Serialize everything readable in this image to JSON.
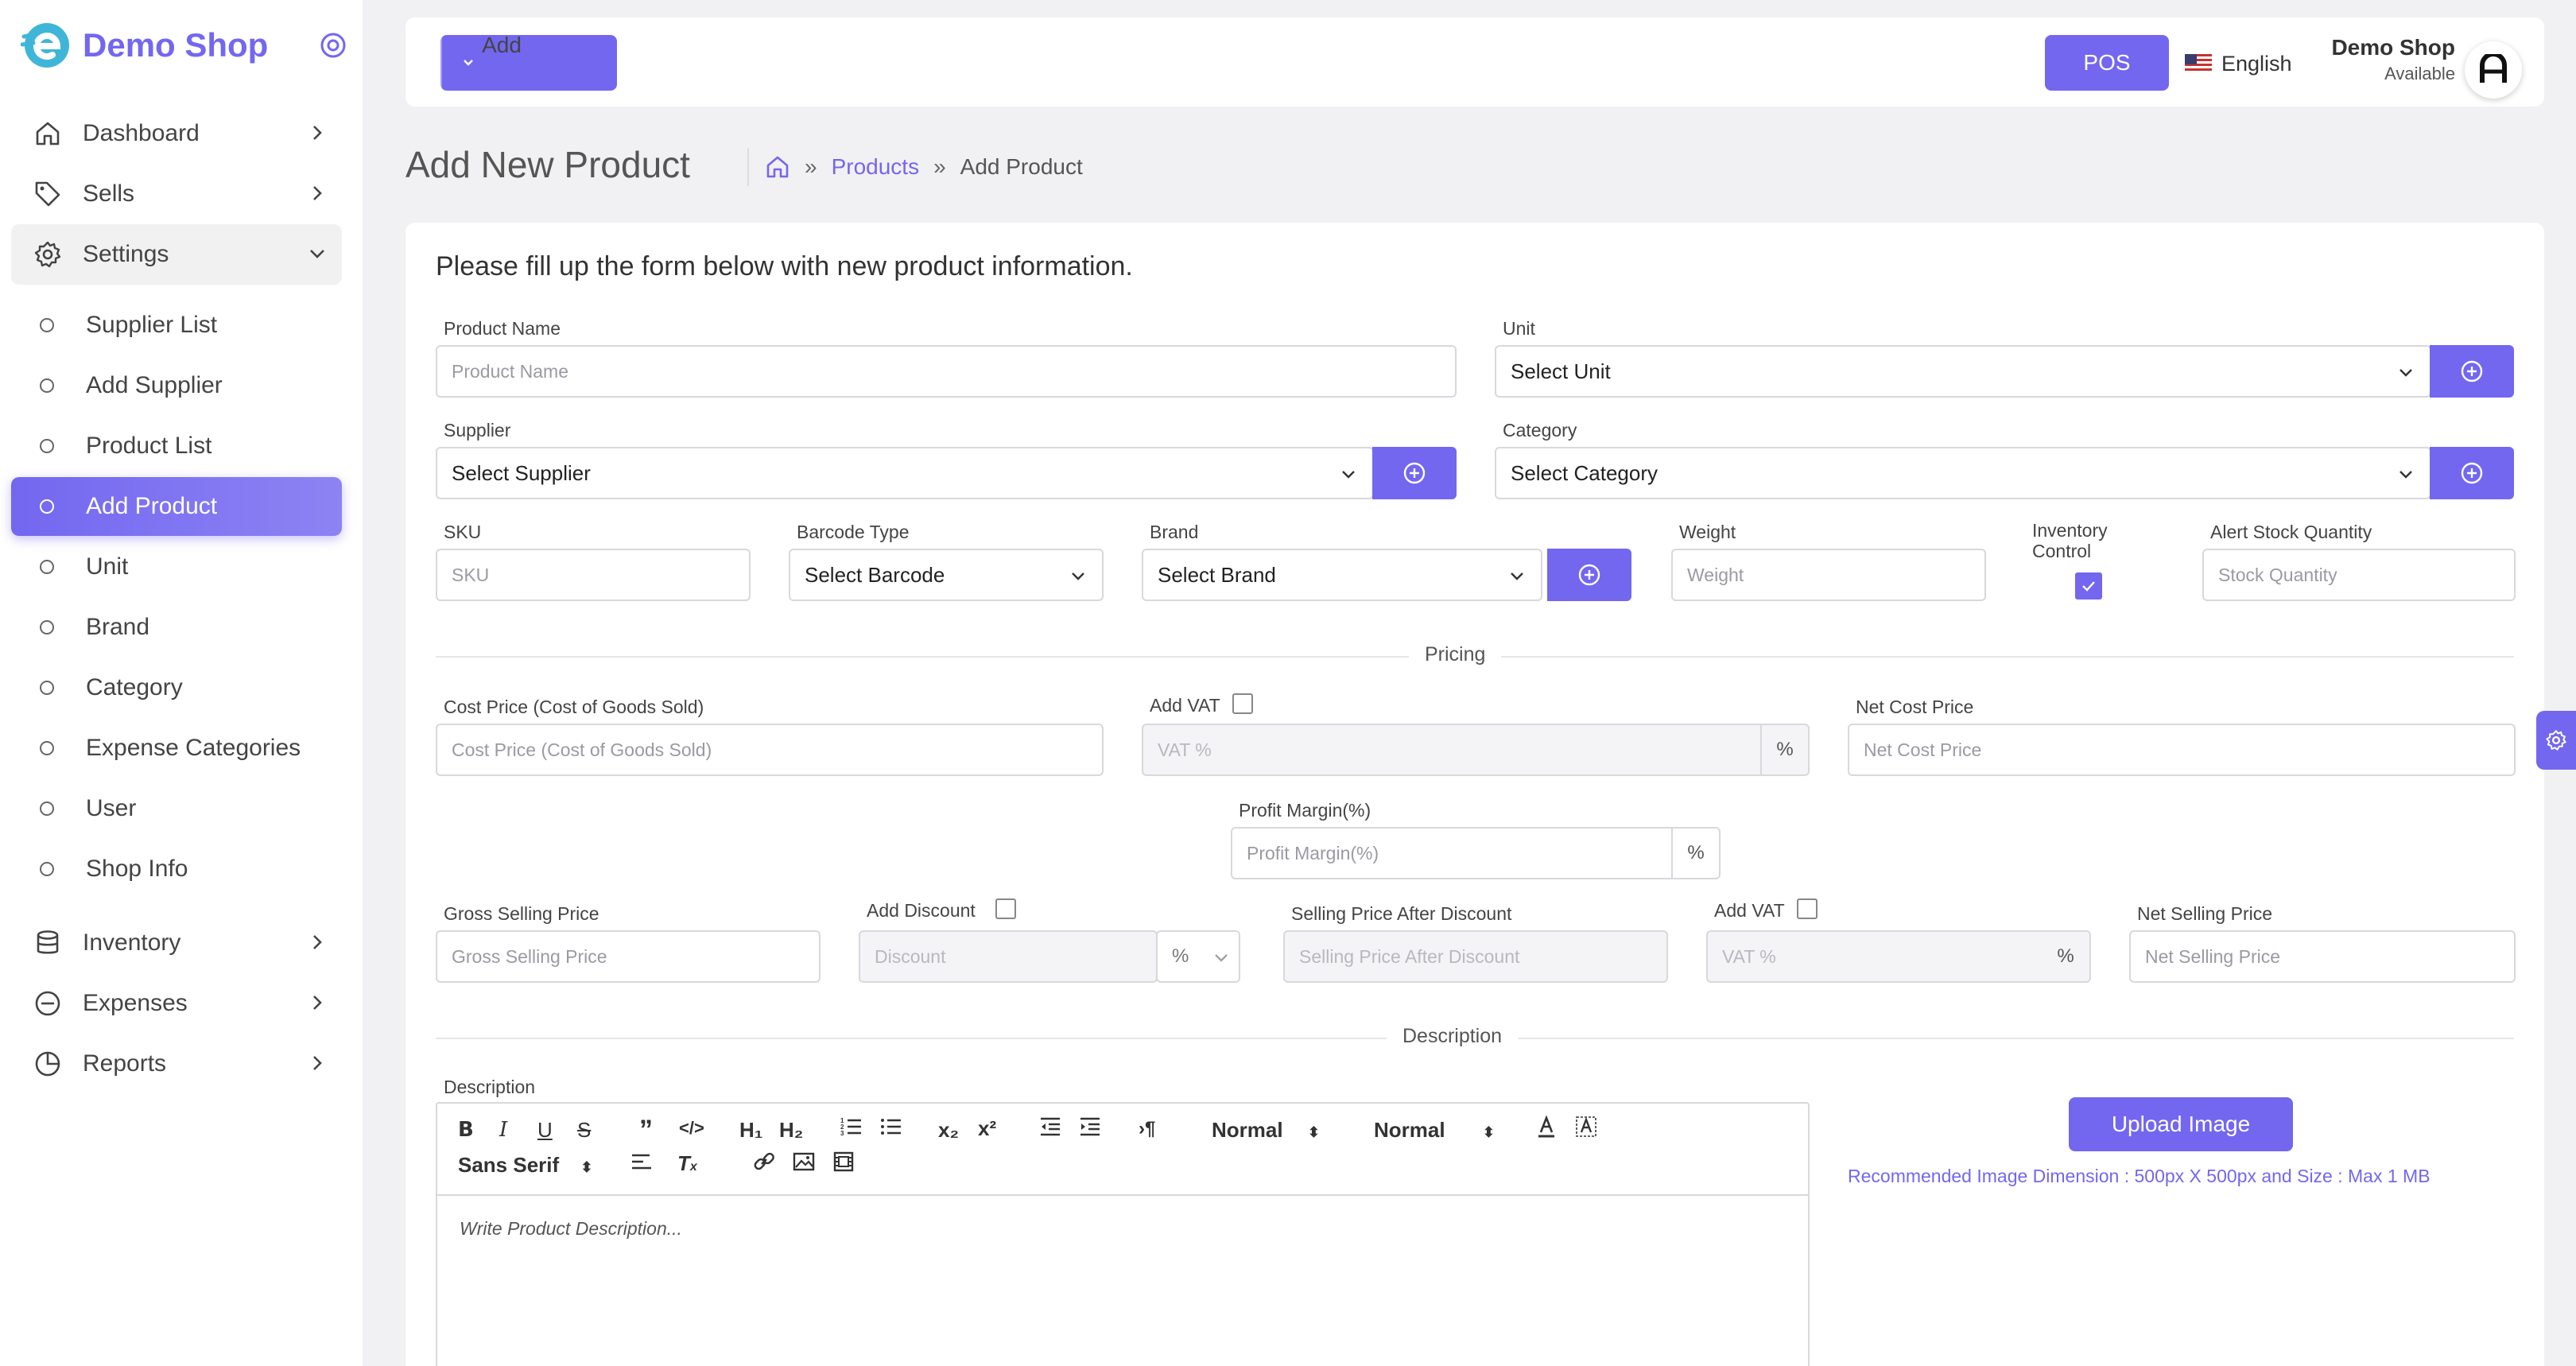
{
  "sidebar": {
    "brand_name": "Demo Shop",
    "items": [
      {
        "label": "Dashboard",
        "icon": "home-icon"
      },
      {
        "label": "Sells",
        "icon": "tag-icon"
      },
      {
        "label": "Settings",
        "icon": "gear-icon"
      },
      {
        "label": "Inventory",
        "icon": "database-icon"
      },
      {
        "label": "Expenses",
        "icon": "minus-circle-icon"
      },
      {
        "label": "Reports",
        "icon": "pie-chart-icon"
      }
    ],
    "settings_children": [
      {
        "label": "Supplier List"
      },
      {
        "label": "Add Supplier"
      },
      {
        "label": "Product List"
      },
      {
        "label": "Add Product"
      },
      {
        "label": "Unit"
      },
      {
        "label": "Brand"
      },
      {
        "label": "Category"
      },
      {
        "label": "Expense Categories"
      },
      {
        "label": "User"
      },
      {
        "label": "Shop Info"
      }
    ]
  },
  "topbar": {
    "add_label": "Add",
    "pos_label": "POS",
    "language": "English",
    "user_name": "Demo Shop",
    "user_status": "Available"
  },
  "page": {
    "title": "Add New Product",
    "breadcrumb": {
      "link": "Products",
      "current": "Add Product"
    }
  },
  "form": {
    "intro": "Please fill up the form below with new product information.",
    "product_name": {
      "label": "Product Name",
      "placeholder": "Product Name"
    },
    "unit": {
      "label": "Unit",
      "value": "Select Unit"
    },
    "supplier": {
      "label": "Supplier",
      "value": "Select Supplier"
    },
    "category": {
      "label": "Category",
      "value": "Select Category"
    },
    "sku": {
      "label": "SKU",
      "placeholder": "SKU"
    },
    "barcode": {
      "label": "Barcode Type",
      "value": "Select Barcode"
    },
    "brand": {
      "label": "Brand",
      "value": "Select Brand"
    },
    "weight": {
      "label": "Weight",
      "placeholder": "Weight"
    },
    "inventory_control": {
      "label_line1": "Inventory",
      "label_line2": "Control",
      "checked": true
    },
    "alert_stock": {
      "label": "Alert Stock Quantity",
      "placeholder": "Stock Quantity"
    },
    "pricing_section": "Pricing",
    "cost_price": {
      "label": "Cost Price (Cost of Goods Sold)",
      "placeholder": "Cost Price (Cost of Goods Sold)"
    },
    "add_vat_1": {
      "label": "Add VAT",
      "placeholder": "VAT %",
      "suffix": "%"
    },
    "net_cost": {
      "label": "Net Cost Price",
      "placeholder": "Net Cost Price"
    },
    "profit_margin": {
      "label": "Profit Margin(%)",
      "placeholder": "Profit Margin(%)",
      "suffix": "%"
    },
    "gross_selling": {
      "label": "Gross Selling Price",
      "placeholder": "Gross Selling Price"
    },
    "add_discount": {
      "label": "Add Discount",
      "placeholder": "Discount",
      "unit": "%"
    },
    "after_discount": {
      "label": "Selling Price After Discount",
      "placeholder": "Selling Price After Discount"
    },
    "add_vat_2": {
      "label": "Add VAT",
      "placeholder": "VAT %",
      "suffix": "%"
    },
    "net_selling": {
      "label": "Net Selling Price",
      "placeholder": "Net Selling Price"
    },
    "description_section": "Description",
    "description": {
      "label": "Description",
      "placeholder": "Write Product Description..."
    },
    "toolbar": {
      "heading_select": "Normal",
      "size_select": "Normal",
      "font_select": "Sans Serif"
    },
    "upload_label": "Upload Image",
    "upload_note": "Recommended Image Dimension : 500px X 500px and Size : Max 1 MB"
  },
  "colors": {
    "accent": "#7367f0"
  }
}
